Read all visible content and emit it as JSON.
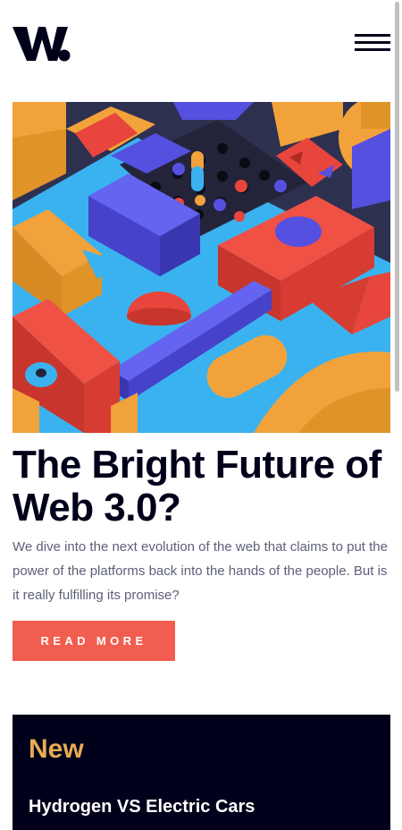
{
  "header": {
    "logo_text": "W.",
    "menu_icon": "hamburger-menu-icon"
  },
  "hero": {
    "image_desc": "abstract-colorful-3d-blocks",
    "colors": {
      "orange": "#f2a23a",
      "red": "#e8453c",
      "blue": "#5550e0",
      "cyan": "#3bb2f0",
      "dark": "#2b2d47"
    }
  },
  "article": {
    "title": "The Bright Future of Web 3.0?",
    "excerpt": "We dive into the next evolution of the web that claims to put the power of the platforms back into the hands of the people. But is it really fulfilling its promise?",
    "cta_label": "Read more"
  },
  "new_panel": {
    "heading": "New",
    "items": [
      {
        "title": "Hydrogen VS Electric Cars"
      }
    ]
  },
  "theme": {
    "accent": "#f15e50",
    "dark": "#00001a",
    "highlight": "#e9ab53",
    "muted_text": "#5d5f79"
  }
}
